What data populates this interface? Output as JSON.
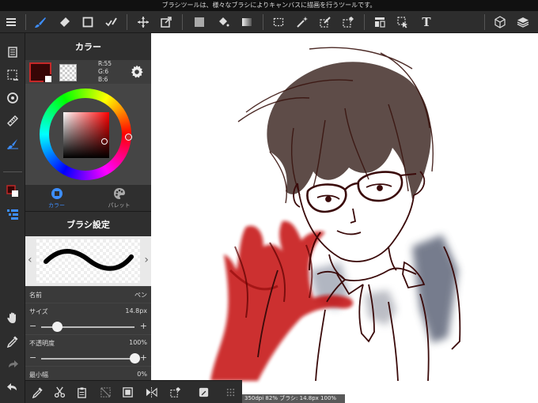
{
  "notice": "ブラシツールは、様々なブラシによりキャンバスに描画を行うツールです。",
  "colors": {
    "accent": "#3d8eff",
    "main_color": "#370606",
    "swatch_border": "#c62828"
  },
  "color_panel": {
    "title": "カラー",
    "rgb": {
      "r": "R:55",
      "g": "G:6",
      "b": "B:6"
    },
    "tabs": [
      {
        "label": "カラー",
        "icon": "circle-icon",
        "active": true
      },
      {
        "label": "パレット",
        "icon": "palette-icon",
        "active": false
      }
    ]
  },
  "brush_panel": {
    "title": "ブラシ設定",
    "name_label": "名前",
    "name_value": "ペン",
    "size_label": "サイズ",
    "size_value": "14.8px",
    "size_level": 0.17,
    "opacity_label": "不透明度",
    "opacity_value": "100%",
    "opacity_level": 1.0,
    "min_width_label": "最小幅",
    "min_width_value": "0%",
    "minus": "−",
    "plus": "+"
  },
  "toolbar": {
    "text_tool": "T",
    "icons": [
      "menu-icon",
      "brush-icon",
      "eraser-icon",
      "shape-icon",
      "check-edit-icon",
      "move-icon",
      "transform-icon",
      "fill-color-icon",
      "bucket-icon",
      "gradient-icon",
      "select-rect-icon",
      "magic-wand-icon",
      "select-pen-icon",
      "select-eraser-icon",
      "panel-icon",
      "select-move-icon",
      "text-icon",
      "3d-icon",
      "layers-icon"
    ]
  },
  "status": "350dpi 82% ブラシ: 14.8px 100%"
}
